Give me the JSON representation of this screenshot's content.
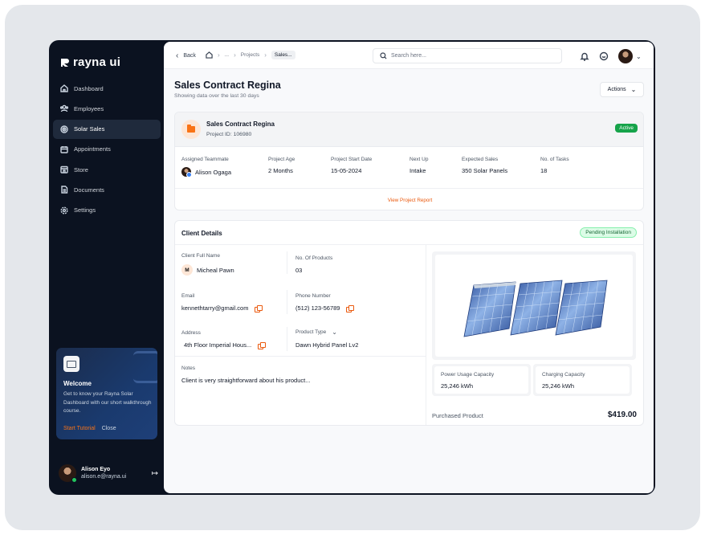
{
  "sidebar": {
    "logo_text": "rayna ui",
    "items": [
      {
        "label": "Dashboard",
        "icon": "home-icon"
      },
      {
        "label": "Employees",
        "icon": "users-icon"
      },
      {
        "label": "Solar Sales",
        "icon": "target-icon",
        "active": true
      },
      {
        "label": "Appointments",
        "icon": "calendar-icon"
      },
      {
        "label": "Store",
        "icon": "store-icon"
      },
      {
        "label": "Documents",
        "icon": "document-icon"
      },
      {
        "label": "Settings",
        "icon": "gear-icon"
      }
    ],
    "welcome": {
      "title": "Welcome",
      "description": "Get to know your Rayna Solar Dashboard with our short walkthrough course.",
      "start_label": "Start Tutorial",
      "close_label": "Close"
    },
    "user": {
      "name": "Alison Eyo",
      "email": "alison.e@rayna.ui"
    }
  },
  "topbar": {
    "back_label": "Back",
    "breadcrumbs": [
      "...",
      "Projects",
      "Sales..."
    ],
    "search_placeholder": "Search here..."
  },
  "page": {
    "title": "Sales Contract Regina",
    "subtitle": "Showing data over the last 30 days",
    "actions_label": "Actions"
  },
  "project": {
    "title": "Sales Contract Regina",
    "id_text": "Project ID: 106980",
    "status": "Active",
    "stats": [
      {
        "label": "Assigned Teammate",
        "value": "Alison Ogaga"
      },
      {
        "label": "Project Age",
        "value": "2 Months"
      },
      {
        "label": "Project Start Date",
        "value": "15-05-2024"
      },
      {
        "label": "Next Up",
        "value": "Intake"
      },
      {
        "label": "Expected Sales",
        "value": "350 Solar Panels"
      },
      {
        "label": "No. of Tasks",
        "value": "18"
      }
    ],
    "report_link": "View Project Report"
  },
  "client": {
    "title": "Client Details",
    "status": "Pending Installation",
    "full_name_label": "Client Full Name",
    "full_name_initial": "M",
    "full_name": "Micheal Pawn",
    "products_label": "No. Of Products",
    "products": "03",
    "email_label": "Email",
    "email": "kennethtarry@gmail.com",
    "phone_label": "Phone Number",
    "phone": "(512) 123-56789",
    "address_label": "Address",
    "address": "4th Floor Imperial Hous...",
    "product_type_label": "Product Type",
    "product_type": "Dawn Hybrid Panel Lv2",
    "notes_label": "Notes",
    "notes": "Client is very straightforward about his product...",
    "power_label": "Power Usage Capacity",
    "power": "25,246 kWh",
    "charging_label": "Charging Capacity",
    "charging": "25,246 kWh",
    "purchased_label": "Purchased Product",
    "price": "$419.00"
  },
  "colors": {
    "accent": "#ea580c",
    "active_green": "#16a34a",
    "sidebar_bg": "#0b1220"
  }
}
